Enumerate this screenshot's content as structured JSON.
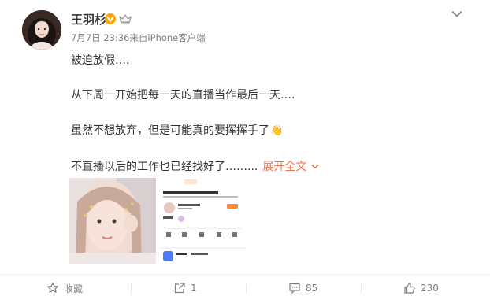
{
  "post": {
    "author": "王羽杉",
    "timestamp": "7月7日 23:36",
    "source": "来自iPhone客户端",
    "lines": [
      "被迫放假….",
      "从下周一开始把每一天的直播当作最后一天….",
      "虽然不想放弃，但是可能真的要挥挥手了",
      "不直播以后的工作也已经找好了……..."
    ],
    "emoji": "👋",
    "expand_label": "展开全文"
  },
  "actions": {
    "favorite_label": "收藏",
    "repost_count": "1",
    "comment_count": "85",
    "like_count": "230"
  },
  "screenshot_thumb": {
    "tabs": [
      "关注",
      "推荐",
      "同城",
      "更多"
    ],
    "headline": "你的一句可以给她加油",
    "user": "王羽杉 ❤"
  },
  "colors": {
    "link": "#eb7350",
    "muted": "#808080",
    "badge": "#ffa500"
  },
  "icons": [
    "v-badge-icon",
    "crown-icon",
    "chevron-down-icon",
    "star-icon",
    "repost-icon",
    "comment-icon",
    "like-icon"
  ]
}
